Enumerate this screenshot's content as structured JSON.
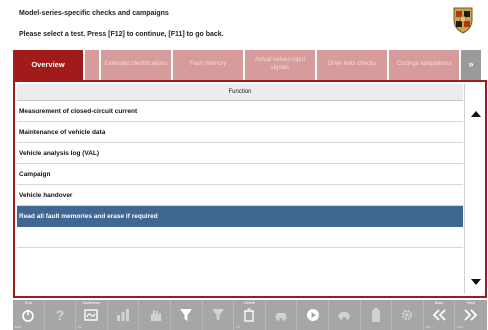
{
  "header": {
    "title": "Model-series-specific checks and campaigns",
    "subtitle": "Please select a test. Press [F12] to continue, [F11] to go back."
  },
  "tabs": [
    {
      "label": "Overview",
      "active": true
    },
    {
      "label": "",
      "active": false
    },
    {
      "label": "Extended identifications",
      "active": false
    },
    {
      "label": "Fault memory",
      "active": false
    },
    {
      "label": "Actual values input signals",
      "active": false
    },
    {
      "label": "Drive links checks",
      "active": false
    },
    {
      "label": "Codings adaptations",
      "active": false
    },
    {
      "label": "»",
      "active": false
    }
  ],
  "list": {
    "header": "Function",
    "rows": [
      {
        "label": "Measurement of closed-circuit current",
        "selected": false
      },
      {
        "label": "Maintenance of vehicle data",
        "selected": false
      },
      {
        "label": "Vehicle analysis log (VAL)",
        "selected": false
      },
      {
        "label": "Campaign",
        "selected": false
      },
      {
        "label": "Vehicle handover",
        "selected": false
      },
      {
        "label": "Read all fault memories and erase if required",
        "selected": true
      },
      {
        "label": "",
        "selected": false
      },
      {
        "label": "",
        "selected": false
      }
    ]
  },
  "toolbar": {
    "buttons": [
      {
        "label": "End",
        "fkey": "ESC",
        "icon": "power-icon"
      },
      {
        "label": "",
        "fkey": "",
        "icon": "help-icon"
      },
      {
        "label": "Multimeter",
        "fkey": "F1",
        "icon": "multimeter-icon"
      },
      {
        "label": "",
        "fkey": "",
        "icon": "chart-icon"
      },
      {
        "label": "",
        "fkey": "",
        "icon": "hand-icon"
      },
      {
        "label": "",
        "fkey": "",
        "icon": "filter-icon"
      },
      {
        "label": "",
        "fkey": "",
        "icon": "funnel-icon"
      },
      {
        "label": "Delete",
        "fkey": "F8",
        "icon": "trash-icon"
      },
      {
        "label": "",
        "fkey": "",
        "icon": "car-icon"
      },
      {
        "label": "",
        "fkey": "",
        "icon": "play-icon"
      },
      {
        "label": "",
        "fkey": "",
        "icon": "vehicle-icon"
      },
      {
        "label": "",
        "fkey": "",
        "icon": "battery-icon"
      },
      {
        "label": "",
        "fkey": "",
        "icon": "gear-icon"
      },
      {
        "label": "Back",
        "fkey": "F11",
        "icon": "back-icon"
      },
      {
        "label": "Next",
        "fkey": "F12",
        "icon": "next-icon"
      }
    ]
  },
  "colors": {
    "accent": "#a31a1a",
    "tab_inactive": "#d89b9b",
    "selection": "#3e6791",
    "toolbar": "#a6a6a6"
  }
}
